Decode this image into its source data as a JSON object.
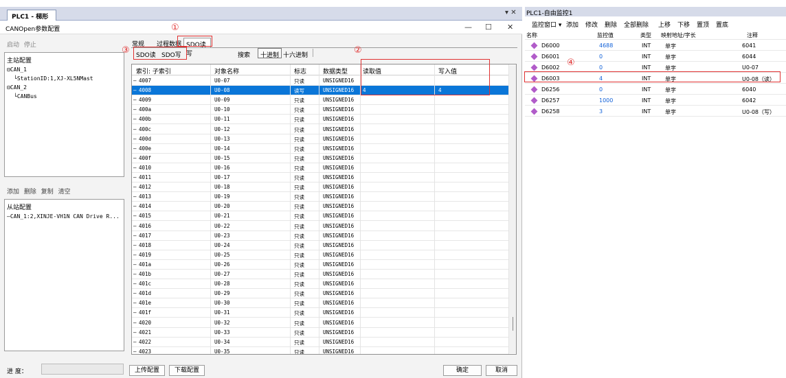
{
  "window": {
    "tab_title": "PLC1 - 梯形图",
    "dialog_title": "CANOpen参数配置"
  },
  "left": {
    "toolbar1": {
      "start": "启动",
      "stop": "停止"
    },
    "master_title": "主站配置",
    "master_tree": [
      "CAN_1",
      "StationID:1,XJ-XL5NMast",
      "CAN_2",
      "CANBus"
    ],
    "toolbar2": {
      "add": "添加",
      "delete": "删除",
      "copy": "复制",
      "clear": "清空"
    },
    "slave_title": "从站配置",
    "slave_tree": [
      "CAN_1:2,XINJE-VH1N CAN Drive R..."
    ],
    "progress_label": "进 度："
  },
  "tabs": {
    "general": "常规",
    "process": "过程数据",
    "sdo": "SDO读写"
  },
  "subtabs": {
    "sdo_read": "SDO读",
    "sdo_write": "SDO写",
    "search": "搜索",
    "decimal": "十进制",
    "hex": "十六进制"
  },
  "table": {
    "headers": [
      "索引: 子索引",
      "对象名称",
      "标志",
      "数据类型",
      "读取值",
      "写入值"
    ],
    "rows": [
      [
        "4007",
        "U0-07",
        "只读",
        "UNSIGNED16",
        "",
        ""
      ],
      [
        "4008",
        "U0-08",
        "读写",
        "UNSIGNED16",
        "4",
        "4"
      ],
      [
        "4009",
        "U0-09",
        "只读",
        "UNSIGNED16",
        "",
        ""
      ],
      [
        "400a",
        "U0-10",
        "只读",
        "UNSIGNED16",
        "",
        ""
      ],
      [
        "400b",
        "U0-11",
        "只读",
        "UNSIGNED16",
        "",
        ""
      ],
      [
        "400c",
        "U0-12",
        "只读",
        "UNSIGNED16",
        "",
        ""
      ],
      [
        "400d",
        "U0-13",
        "只读",
        "UNSIGNED16",
        "",
        ""
      ],
      [
        "400e",
        "U0-14",
        "只读",
        "UNSIGNED16",
        "",
        ""
      ],
      [
        "400f",
        "U0-15",
        "只读",
        "UNSIGNED16",
        "",
        ""
      ],
      [
        "4010",
        "U0-16",
        "只读",
        "UNSIGNED16",
        "",
        ""
      ],
      [
        "4011",
        "U0-17",
        "只读",
        "UNSIGNED16",
        "",
        ""
      ],
      [
        "4012",
        "U0-18",
        "只读",
        "UNSIGNED16",
        "",
        ""
      ],
      [
        "4013",
        "U0-19",
        "只读",
        "UNSIGNED16",
        "",
        ""
      ],
      [
        "4014",
        "U0-20",
        "只读",
        "UNSIGNED16",
        "",
        ""
      ],
      [
        "4015",
        "U0-21",
        "只读",
        "UNSIGNED16",
        "",
        ""
      ],
      [
        "4016",
        "U0-22",
        "只读",
        "UNSIGNED16",
        "",
        ""
      ],
      [
        "4017",
        "U0-23",
        "只读",
        "UNSIGNED16",
        "",
        ""
      ],
      [
        "4018",
        "U0-24",
        "只读",
        "UNSIGNED16",
        "",
        ""
      ],
      [
        "4019",
        "U0-25",
        "只读",
        "UNSIGNED16",
        "",
        ""
      ],
      [
        "401a",
        "U0-26",
        "只读",
        "UNSIGNED16",
        "",
        ""
      ],
      [
        "401b",
        "U0-27",
        "只读",
        "UNSIGNED16",
        "",
        ""
      ],
      [
        "401c",
        "U0-28",
        "只读",
        "UNSIGNED16",
        "",
        ""
      ],
      [
        "401d",
        "U0-29",
        "只读",
        "UNSIGNED16",
        "",
        ""
      ],
      [
        "401e",
        "U0-30",
        "只读",
        "UNSIGNED16",
        "",
        ""
      ],
      [
        "401f",
        "U0-31",
        "只读",
        "UNSIGNED16",
        "",
        ""
      ],
      [
        "4020",
        "U0-32",
        "只读",
        "UNSIGNED16",
        "",
        ""
      ],
      [
        "4021",
        "U0-33",
        "只读",
        "UNSIGNED16",
        "",
        ""
      ],
      [
        "4022",
        "U0-34",
        "只读",
        "UNSIGNED16",
        "",
        ""
      ],
      [
        "4023",
        "U0-35",
        "只读",
        "UNSIGNED16",
        "",
        ""
      ],
      [
        "4024",
        "U0-36",
        "只读",
        "UNSIGNED16",
        "",
        ""
      ]
    ],
    "selected_index": 1
  },
  "footer": {
    "upload": "上传配置",
    "download": "下载配置",
    "ok": "确定",
    "cancel": "取消"
  },
  "markers": [
    "①",
    "②",
    "③",
    "④"
  ],
  "right": {
    "title": "PLC1-自由监控1",
    "toolbar": [
      "监控窗口 ▾",
      "添加",
      "修改",
      "删除",
      "全部删除",
      "上移",
      "下移",
      "置顶",
      "置底"
    ],
    "headers": [
      "名称",
      "监控值",
      "类型",
      "映射地址/字长",
      "注释"
    ],
    "rows": [
      [
        "D6000",
        "4688",
        "INT",
        "单字",
        "6041"
      ],
      [
        "D6001",
        "0",
        "INT",
        "单字",
        "6044"
      ],
      [
        "D6002",
        "0",
        "INT",
        "单字",
        "U0-07"
      ],
      [
        "D6003",
        "4",
        "INT",
        "单字",
        "U0-08（读）"
      ],
      [
        "D6256",
        "0",
        "INT",
        "单字",
        "6040"
      ],
      [
        "D6257",
        "1000",
        "INT",
        "单字",
        "6042"
      ],
      [
        "D6258",
        "3",
        "INT",
        "单字",
        "U0-08（写）"
      ]
    ]
  },
  "colors": {
    "accent": "#0a76d8",
    "highlight": "#e03030"
  }
}
